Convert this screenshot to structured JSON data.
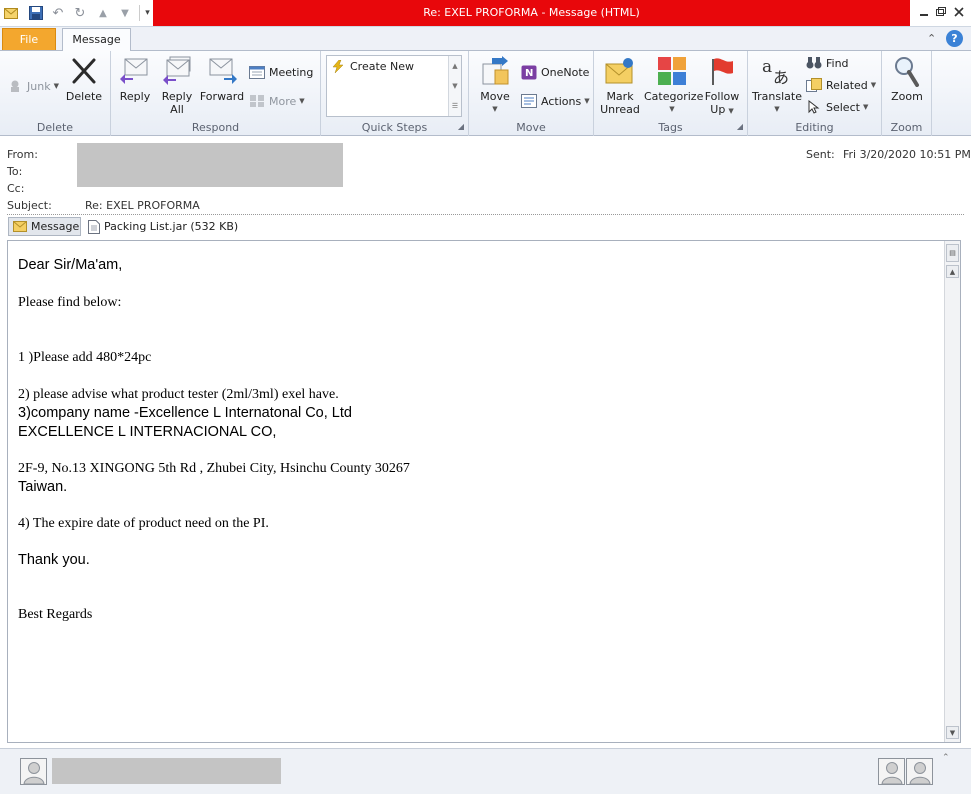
{
  "window": {
    "title": "Re: EXEL PROFORMA - Message (HTML)",
    "controls": [
      "minimize",
      "restore",
      "close"
    ]
  },
  "tabs": {
    "file": "File",
    "message": "Message"
  },
  "ribbon": {
    "delete_group": {
      "label": "Delete",
      "junk": "Junk",
      "delete": "Delete"
    },
    "respond_group": {
      "label": "Respond",
      "reply": "Reply",
      "reply_all_1": "Reply",
      "reply_all_2": "All",
      "forward": "Forward",
      "meeting": "Meeting",
      "more": "More"
    },
    "quicksteps_group": {
      "label": "Quick Steps",
      "create_new": "Create New"
    },
    "move_group": {
      "label": "Move",
      "move": "Move",
      "onenote": "OneNote",
      "actions": "Actions"
    },
    "tags_group": {
      "label": "Tags",
      "mark_unread_1": "Mark",
      "mark_unread_2": "Unread",
      "categorize": "Categorize",
      "follow_up_1": "Follow",
      "follow_up_2": "Up"
    },
    "editing_group": {
      "label": "Editing",
      "translate": "Translate",
      "find": "Find",
      "related": "Related",
      "select": "Select"
    },
    "zoom_group": {
      "label": "Zoom",
      "zoom": "Zoom"
    }
  },
  "header": {
    "from_label": "From:",
    "to_label": "To:",
    "cc_label": "Cc:",
    "subject_label": "Subject:",
    "subject": "Re: EXEL PROFORMA",
    "sent_label": "Sent:",
    "sent": "Fri 3/20/2020 10:51 PM",
    "attachments": {
      "message_tab": "Message",
      "file": "Packing List.jar (532 KB)"
    }
  },
  "body": {
    "greeting": "Dear Sir/Ma'am,",
    "intro": "Please find below:",
    "item1": "1 )Please add 480*24pc",
    "item2": "2) please advise what product tester (2ml/3ml) exel have.",
    "item3": "3)company name -Excellence L Internatonal Co, Ltd",
    "company": "EXCELLENCE L INTERNACIONAL CO,",
    "address": "2F-9, No.13 XINGONG 5th Rd , Zhubei City, Hsinchu County 30267",
    "country": "Taiwan.",
    "item4": "4) The  expire date of product need on the PI.",
    "thanks": "Thank you.",
    "signoff": "Best Regards"
  },
  "colors": {
    "title_accent": "#e8070b",
    "file_tab": "#f3a72e",
    "ribbon_bg": "#eef1f7"
  }
}
